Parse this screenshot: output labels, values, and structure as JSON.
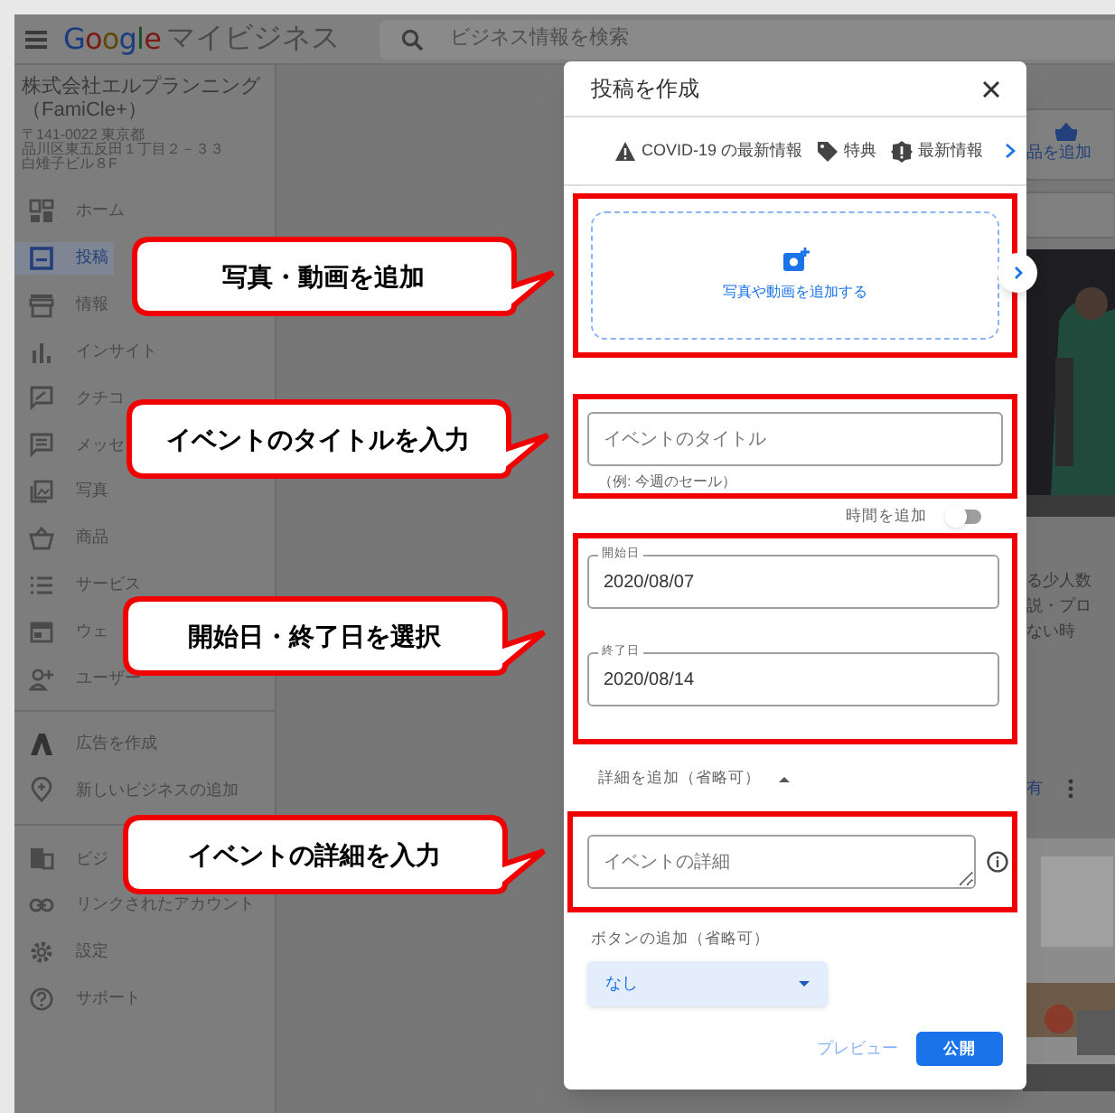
{
  "app": {
    "logo": "Google",
    "product": "マイビジネス",
    "search_placeholder": "ビジネス情報を検索"
  },
  "business": {
    "name": "株式会社エルプランニング（FamiCle+）",
    "address": [
      "〒141-0022 東京都",
      "品川区東五反田１丁目２－３３",
      "白雉子ビル８F"
    ]
  },
  "sidebar": {
    "groups": [
      [
        {
          "label": "ホーム",
          "selected": false
        },
        {
          "label": "投稿",
          "selected": true
        },
        {
          "label": "情報",
          "selected": false
        },
        {
          "label": "インサイト",
          "selected": false
        },
        {
          "label": "クチコ",
          "selected": false
        },
        {
          "label": "メッセ",
          "selected": false
        },
        {
          "label": "写真",
          "selected": false
        },
        {
          "label": "商品",
          "selected": false
        },
        {
          "label": "サービス",
          "selected": false
        },
        {
          "label": "ウェ",
          "selected": false
        },
        {
          "label": "ユーザー",
          "selected": false
        }
      ],
      [
        {
          "label": "広告を作成",
          "selected": false
        },
        {
          "label": "新しいビジネスの追加",
          "selected": false
        }
      ],
      [
        {
          "label": "ビジ",
          "selected": false
        },
        {
          "label": "リンクされたアカウント",
          "selected": false
        },
        {
          "label": "設定",
          "selected": false
        },
        {
          "label": "サポート",
          "selected": false
        }
      ]
    ]
  },
  "background": {
    "add_button": "品を追加",
    "snippet": [
      "る少人数",
      "説・プロ",
      "ない時"
    ],
    "share": "有"
  },
  "dialog": {
    "title": "投稿を作成",
    "tabs": [
      {
        "label": "COVID-19 の最新情報",
        "selected": false
      },
      {
        "label": "特典",
        "selected": false
      },
      {
        "label": "最新情報",
        "selected": false
      }
    ],
    "media": {
      "label": "写真や動画を追加する"
    },
    "title_field": {
      "placeholder": "イベントのタイトル",
      "helper": "（例: 今週のセール）"
    },
    "add_time": {
      "label": "時間を追加",
      "on": false
    },
    "start_date": {
      "label": "開始日",
      "value": "2020/08/07"
    },
    "end_date": {
      "label": "終了日",
      "value": "2020/08/14"
    },
    "details_toggle": {
      "label": "詳細を追加（省略可）",
      "expanded": true
    },
    "details_field": {
      "placeholder": "イベントの詳細"
    },
    "button_section": {
      "label": "ボタンの追加（省略可）",
      "value": "なし"
    },
    "actions": {
      "preview": "プレビュー",
      "publish": "公開"
    }
  },
  "callouts": [
    "写真・動画を追加",
    "イベントのタイトルを入力",
    "開始日・終了日を選択",
    "イベントの詳細を入力"
  ]
}
